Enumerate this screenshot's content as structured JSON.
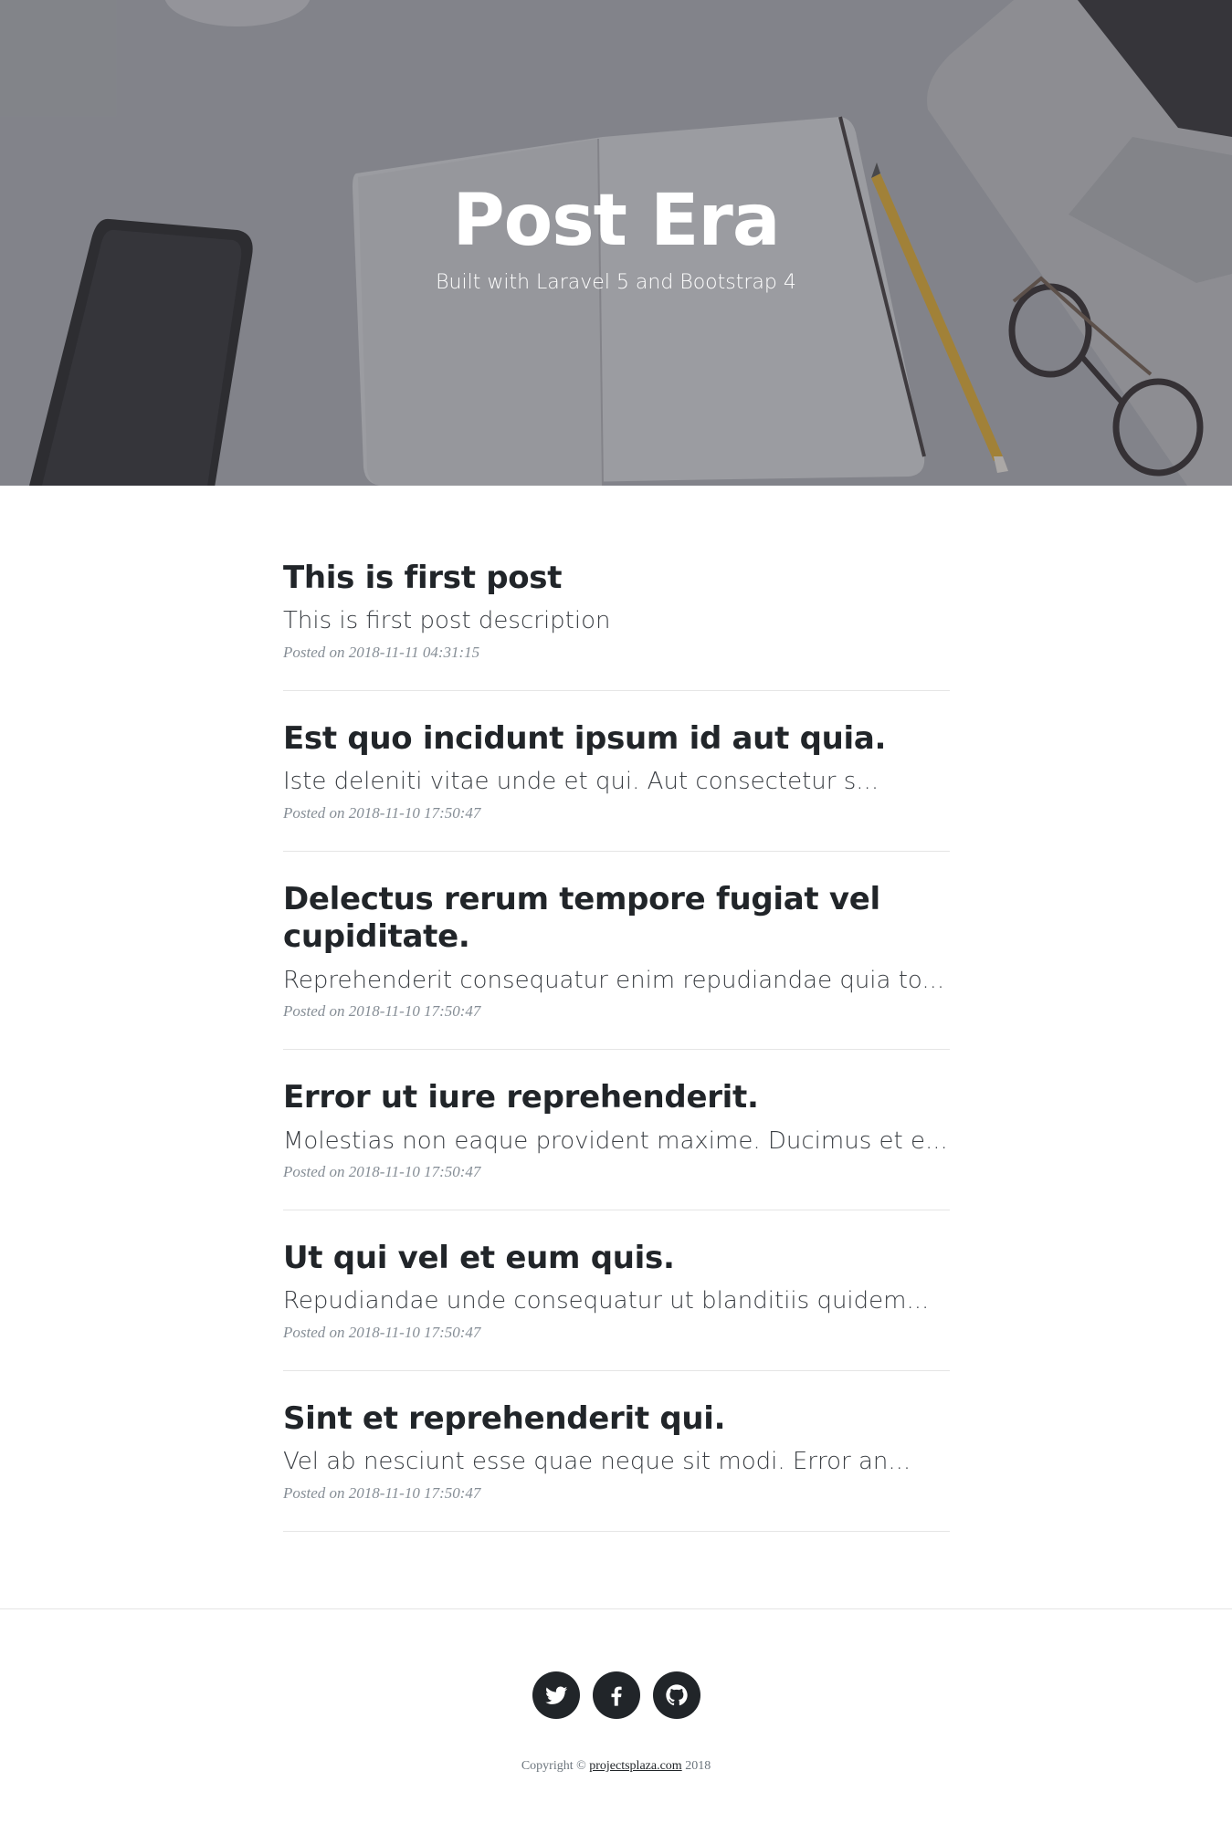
{
  "hero": {
    "title": "Post Era",
    "subtitle": "Built with Laravel 5 and Bootstrap 4"
  },
  "posts": [
    {
      "title": "This is first post",
      "description": "This is first post description",
      "posted": "Posted on 2018-11-11 04:31:15"
    },
    {
      "title": "Est quo incidunt ipsum id aut quia.",
      "description": "Iste deleniti vitae unde et qui. Aut consectetur s...",
      "posted": "Posted on 2018-11-10 17:50:47"
    },
    {
      "title": "Delectus rerum tempore fugiat vel cupiditate.",
      "description": "Reprehenderit consequatur enim repudiandae quia to...",
      "posted": "Posted on 2018-11-10 17:50:47"
    },
    {
      "title": "Error ut iure reprehenderit.",
      "description": "Molestias non eaque provident maxime. Ducimus et e...",
      "posted": "Posted on 2018-11-10 17:50:47"
    },
    {
      "title": "Ut qui vel et eum quis.",
      "description": "Repudiandae unde consequatur ut blanditiis quidem...",
      "posted": "Posted on 2018-11-10 17:50:47"
    },
    {
      "title": "Sint et reprehenderit qui.",
      "description": "Vel ab nesciunt esse quae neque sit modi. Error an...",
      "posted": "Posted on 2018-11-10 17:50:47"
    }
  ],
  "footer": {
    "social": [
      {
        "icon": "twitter-icon"
      },
      {
        "icon": "facebook-icon"
      },
      {
        "icon": "github-icon"
      }
    ],
    "copyright_prefix": "Copyright ©",
    "copyright_link": "projectsplaza.com",
    "copyright_year": "2018"
  }
}
